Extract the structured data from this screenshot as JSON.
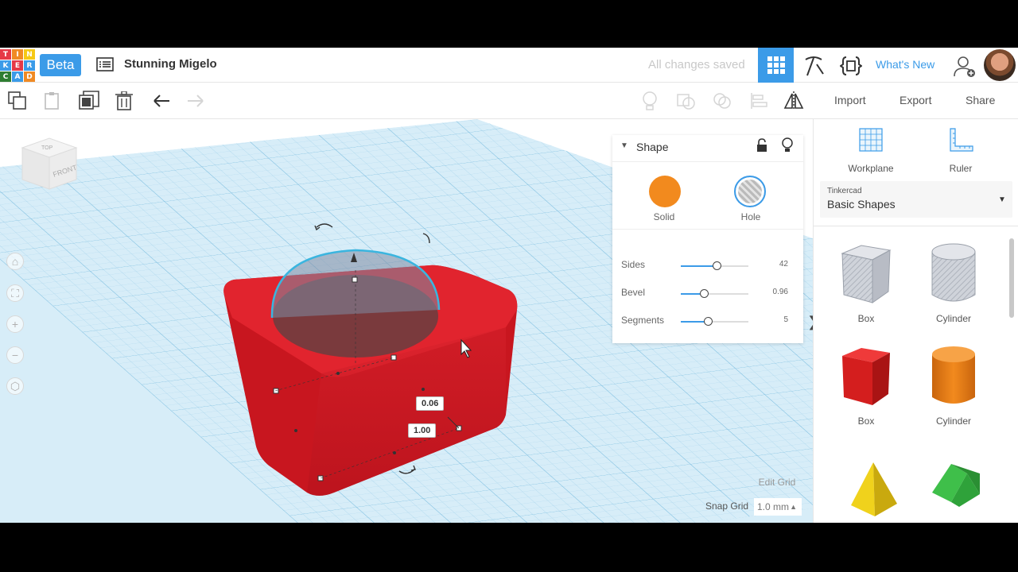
{
  "topbar": {
    "logo_letters": [
      "T",
      "I",
      "N",
      "K",
      "E",
      "R",
      "C",
      "A",
      "D"
    ],
    "logo_colors": [
      "#e63946",
      "#f08a24",
      "#f6c915",
      "#3b9be8",
      "#e63946",
      "#3b9be8",
      "#2e7d32",
      "#3b9be8",
      "#f08a24"
    ],
    "beta_label": "Beta",
    "design_title": "Stunning Migelo",
    "save_status": "All changes saved",
    "whats_new_label": "What's New"
  },
  "toolbar": {
    "import_label": "Import",
    "export_label": "Export",
    "share_label": "Share"
  },
  "viewcube": {
    "top_label": "TOP",
    "front_label": "FRONT"
  },
  "dimensions": {
    "height_value": "0.06",
    "width_value": "1.00"
  },
  "shape_panel": {
    "title": "Shape",
    "solid_label": "Solid",
    "hole_label": "Hole",
    "solid_color": "#f28a1e",
    "params": [
      {
        "label": "Sides",
        "value": "42",
        "fraction": 0.53
      },
      {
        "label": "Bevel",
        "value": "0.96",
        "fraction": 0.34
      },
      {
        "label": "Segments",
        "value": "5",
        "fraction": 0.4
      }
    ]
  },
  "right_panel": {
    "workplane_label": "Workplane",
    "ruler_label": "Ruler",
    "library_small": "Tinkercad",
    "library_name": "Basic Shapes",
    "shapes": [
      {
        "label": "Box"
      },
      {
        "label": "Cylinder"
      },
      {
        "label": "Box"
      },
      {
        "label": "Cylinder"
      }
    ]
  },
  "grid_controls": {
    "edit_grid_label": "Edit Grid",
    "snap_grid_label": "Snap Grid",
    "snap_grid_value": "1.0 mm"
  },
  "colors": {
    "accent": "#3b9be8",
    "box_red": "#d21f2a",
    "workplane": "#cfe8f5"
  }
}
